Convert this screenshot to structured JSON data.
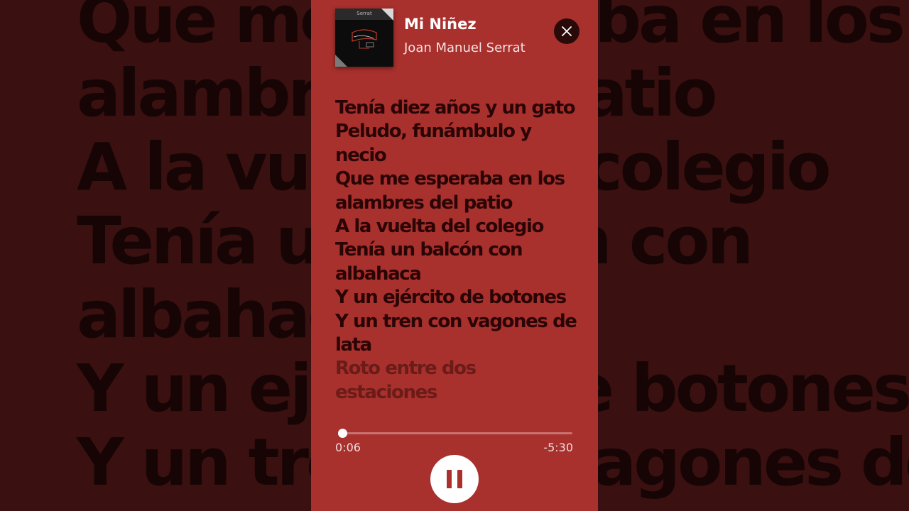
{
  "background_lyrics": [
    "Que me esperaba en los",
    "alambres del patio",
    "A la vuelta del colegio",
    "Tenía un balcón con",
    "albahaca",
    "Y un ejército de botones",
    "Y un tren con vagones de"
  ],
  "now_playing": {
    "album_label": "Serrat",
    "title": "Mi Niñez",
    "artist": "Joan Manuel Serrat"
  },
  "lyrics": [
    "Tenía diez años y un gato",
    "Peludo, funámbulo y",
    "necio",
    "Que me esperaba en los",
    "alambres del patio",
    "A la vuelta del colegio",
    "Tenía un balcón con",
    "albahaca",
    "Y un ejército de botones",
    "Y un tren con vagones de",
    "lata",
    "Roto entre dos estaciones"
  ],
  "playback": {
    "elapsed": "0:06",
    "remaining": "-5:30",
    "progress_fraction": 0.018,
    "state": "playing"
  },
  "icons": {
    "close": "close-icon",
    "pause": "pause-icon"
  },
  "colors": {
    "panel": "#a8302d",
    "background": "#3a1010",
    "lyrics_text": "#2a0505"
  }
}
